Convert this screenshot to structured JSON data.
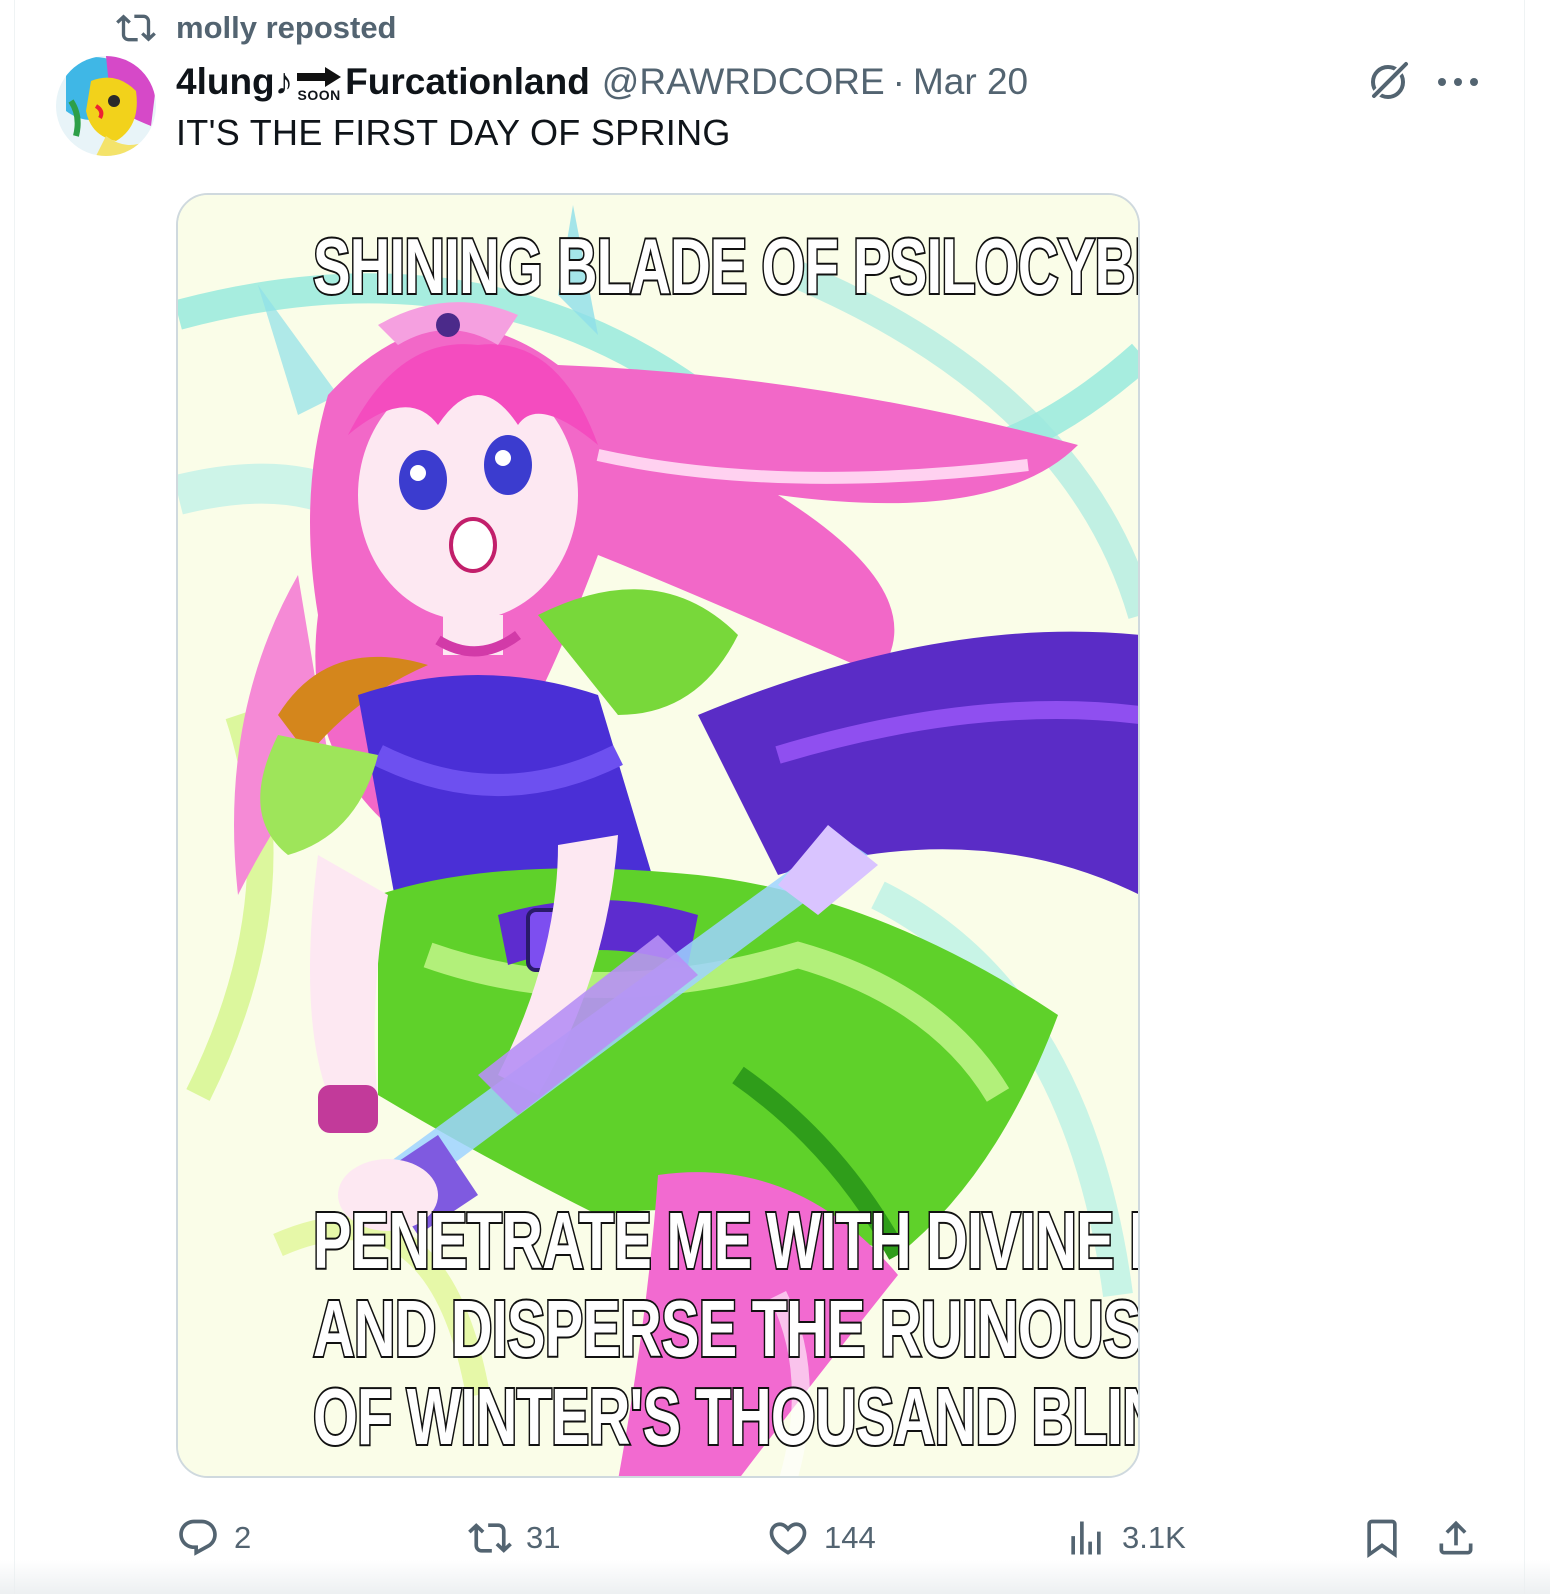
{
  "repost": {
    "label": "molly reposted",
    "icon": "repost-icon"
  },
  "tweet": {
    "display_name_part1": "4lung♪",
    "badge_text": "SOON",
    "display_name_part2": "Furcationland",
    "handle": "@RAWRDCORE",
    "separator": "·",
    "date": "Mar 20",
    "text": "IT'S THE FIRST DAY OF SPRING"
  },
  "media": {
    "top_caption": "SHINING BLADE OF PSILOCYBIN",
    "bottom_caption": [
      "PENETRATE ME WITH DIVINE LIGHT",
      "AND DISPERSE THE RUINOUS HAZE",
      "OF WINTER'S THOUSAND BLINKERS"
    ]
  },
  "actions": {
    "replies": "2",
    "reposts": "31",
    "likes": "144",
    "views": "3.1K"
  },
  "colors": {
    "text_primary": "#0f1419",
    "text_secondary": "#536471",
    "border": "#cfd9de"
  }
}
